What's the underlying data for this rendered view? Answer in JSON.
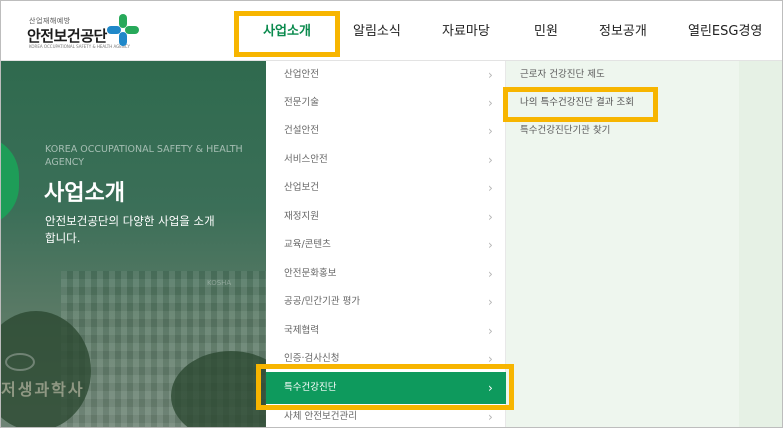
{
  "header": {
    "logo": {
      "small": "산업재해예방",
      "name": "안전보건공단",
      "sub": "KOREA OCCUPATIONAL SAFETY & HEALTH AGENCY"
    },
    "nav": [
      {
        "label": "사업소개",
        "active": true
      },
      {
        "label": "알림소식",
        "active": false
      },
      {
        "label": "자료마당",
        "active": false
      },
      {
        "label": "민원",
        "active": false
      },
      {
        "label": "정보공개",
        "active": false
      },
      {
        "label": "열린ESG경영",
        "active": false
      }
    ]
  },
  "hero": {
    "eng": "KOREA OCCUPATIONAL SAFETY & HEALTH AGENCY",
    "title": "사업소개",
    "desc": "안전보건공단의 다양한 사업을 소개합니다.",
    "sign": "저생과학사",
    "building_label": "KOSHA"
  },
  "menu1": {
    "items": [
      {
        "label": "산업안전"
      },
      {
        "label": "전문기술"
      },
      {
        "label": "건설안전"
      },
      {
        "label": "서비스안전"
      },
      {
        "label": "산업보건"
      },
      {
        "label": "재정지원"
      },
      {
        "label": "교육/콘텐츠"
      },
      {
        "label": "안전문화홍보"
      },
      {
        "label": "공공/민간기관 평가"
      },
      {
        "label": "국제협력"
      },
      {
        "label": "인증·검사신청"
      },
      {
        "label": "특수건강진단",
        "selected": true
      },
      {
        "label": "사체 안전보건관리"
      }
    ],
    "chevron": "›"
  },
  "menu2": {
    "items": [
      {
        "label": "근로자 건강진단 제도"
      },
      {
        "label": "나의 특수건강진단 결과 조회",
        "highlight": true
      },
      {
        "label": "특수건강진단기관 찾기"
      }
    ]
  },
  "colors": {
    "brand_green": "#0e9a5d",
    "highlight_box": "#f7b500",
    "submenu_bg": "#eef6ee"
  },
  "icons": {
    "logo": "kosha-cross-logo",
    "chevron": "chevron-right-icon"
  }
}
